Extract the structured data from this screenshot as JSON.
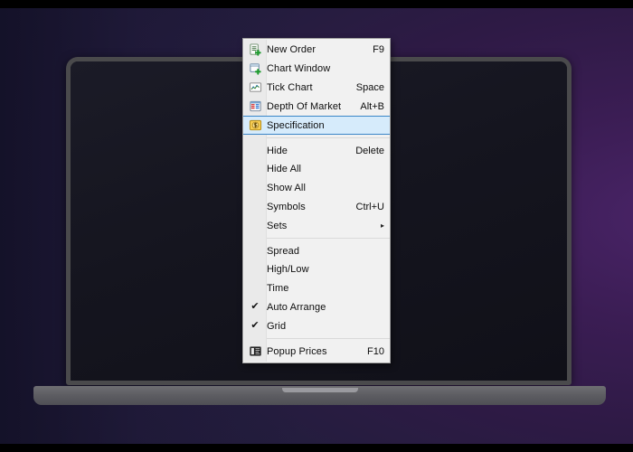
{
  "scene": {
    "background_outer": "#000000",
    "wallpaper_gradient_from": "#4a2468",
    "wallpaper_gradient_to": "#201b38",
    "device": "laptop",
    "screen_color": "#161620",
    "bezel_color": "#4a4a4c",
    "base_color": "#5e5e63"
  },
  "context_menu": {
    "name": "market-watch-context-menu",
    "background": "#f1f1f1",
    "border_color": "#a0a0a0",
    "highlight_background": "#d6ebfb",
    "highlight_border": "#3a86c8",
    "items": [
      {
        "label": "New Order",
        "accel": "F9",
        "icon": "new-order-icon",
        "type": "item",
        "checked": false,
        "highlighted": false,
        "submenu": false
      },
      {
        "label": "Chart Window",
        "accel": "",
        "icon": "chart-window-icon",
        "type": "item",
        "checked": false,
        "highlighted": false,
        "submenu": false
      },
      {
        "label": "Tick Chart",
        "accel": "Space",
        "icon": "tick-chart-icon",
        "type": "item",
        "checked": false,
        "highlighted": false,
        "submenu": false
      },
      {
        "label": "Depth Of Market",
        "accel": "Alt+B",
        "icon": "depth-of-market-icon",
        "type": "item",
        "checked": false,
        "highlighted": false,
        "submenu": false
      },
      {
        "label": "Specification",
        "accel": "",
        "icon": "specification-icon",
        "type": "item",
        "checked": false,
        "highlighted": true,
        "submenu": false
      },
      {
        "label": "",
        "accel": "",
        "icon": "",
        "type": "separator",
        "checked": false,
        "highlighted": false,
        "submenu": false
      },
      {
        "label": "Hide",
        "accel": "Delete",
        "icon": "",
        "type": "item",
        "checked": false,
        "highlighted": false,
        "submenu": false
      },
      {
        "label": "Hide All",
        "accel": "",
        "icon": "",
        "type": "item",
        "checked": false,
        "highlighted": false,
        "submenu": false
      },
      {
        "label": "Show All",
        "accel": "",
        "icon": "",
        "type": "item",
        "checked": false,
        "highlighted": false,
        "submenu": false
      },
      {
        "label": "Symbols",
        "accel": "Ctrl+U",
        "icon": "",
        "type": "item",
        "checked": false,
        "highlighted": false,
        "submenu": false
      },
      {
        "label": "Sets",
        "accel": "",
        "icon": "",
        "type": "item",
        "checked": false,
        "highlighted": false,
        "submenu": true
      },
      {
        "label": "",
        "accel": "",
        "icon": "",
        "type": "separator",
        "checked": false,
        "highlighted": false,
        "submenu": false
      },
      {
        "label": "Spread",
        "accel": "",
        "icon": "",
        "type": "item",
        "checked": false,
        "highlighted": false,
        "submenu": false
      },
      {
        "label": "High/Low",
        "accel": "",
        "icon": "",
        "type": "item",
        "checked": false,
        "highlighted": false,
        "submenu": false
      },
      {
        "label": "Time",
        "accel": "",
        "icon": "",
        "type": "item",
        "checked": false,
        "highlighted": false,
        "submenu": false
      },
      {
        "label": "Auto Arrange",
        "accel": "",
        "icon": "check-icon",
        "type": "item",
        "checked": true,
        "highlighted": false,
        "submenu": false
      },
      {
        "label": "Grid",
        "accel": "",
        "icon": "check-icon",
        "type": "item",
        "checked": true,
        "highlighted": false,
        "submenu": false
      },
      {
        "label": "",
        "accel": "",
        "icon": "",
        "type": "separator",
        "checked": false,
        "highlighted": false,
        "submenu": false
      },
      {
        "label": "Popup Prices",
        "accel": "F10",
        "icon": "popup-prices-icon",
        "type": "item",
        "checked": false,
        "highlighted": false,
        "submenu": false
      }
    ],
    "submenu_arrow_glyph": "▸",
    "check_glyph": "✔"
  }
}
